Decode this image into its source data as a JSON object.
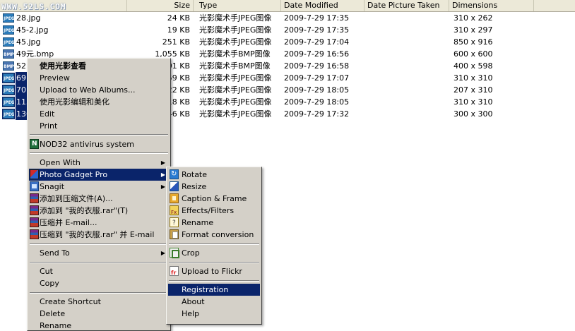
{
  "watermark": "WWW.52LS.COM",
  "columns": {
    "size": "Size",
    "type": "Type",
    "date_modified": "Date Modified",
    "date_taken": "Date Picture Taken",
    "dimensions": "Dimensions"
  },
  "files": [
    {
      "icon": "JPEG",
      "name": "28.jpg",
      "size": "24 KB",
      "type": "光影魔术手JPEG图像",
      "modified": "2009-7-29 17:35",
      "dimensions": "310 x 262",
      "selected": false
    },
    {
      "icon": "JPEG",
      "name": "45-2.jpg",
      "size": "19 KB",
      "type": "光影魔术手JPEG图像",
      "modified": "2009-7-29 17:35",
      "dimensions": "310 x 297",
      "selected": false
    },
    {
      "icon": "JPEG",
      "name": "45.jpg",
      "size": "251 KB",
      "type": "光影魔术手JPEG图像",
      "modified": "2009-7-29 17:04",
      "dimensions": "850 x 916",
      "selected": false
    },
    {
      "icon": "BMP",
      "name": "49元.bmp",
      "size": "1,055 KB",
      "type": "光影魔术手BMP图像",
      "modified": "2009-7-29 16:56",
      "dimensions": "600 x 600",
      "selected": false
    },
    {
      "icon": "BMP",
      "name": "52.",
      "size": "701 KB",
      "type": "光影魔术手BMP图像",
      "modified": "2009-7-29 16:58",
      "dimensions": "400 x 598",
      "selected": false
    },
    {
      "icon": "JPEG",
      "name": "69.",
      "size": "59 KB",
      "type": "光影魔术手JPEG图像",
      "modified": "2009-7-29 17:07",
      "dimensions": "310 x 310",
      "selected": true
    },
    {
      "icon": "JPEG",
      "name": "70.",
      "size": "22 KB",
      "type": "光影魔术手JPEG图像",
      "modified": "2009-7-29 18:05",
      "dimensions": "207 x 310",
      "selected": true
    },
    {
      "icon": "JPEG",
      "name": "115",
      "size": "18 KB",
      "type": "光影魔术手JPEG图像",
      "modified": "2009-7-29 18:05",
      "dimensions": "310 x 310",
      "selected": true
    },
    {
      "icon": "JPEG",
      "name": "136",
      "size": "46 KB",
      "type": "光影魔术手JPEG图像",
      "modified": "2009-7-29 17:32",
      "dimensions": "300 x 300",
      "selected": true
    }
  ],
  "context_menu": {
    "open_with_guangying": "使用光影查看",
    "preview": "Preview",
    "upload_web_albums": "Upload to Web Albums...",
    "edit_with_guangying": "使用光影编辑和美化",
    "edit": "Edit",
    "print": "Print",
    "nod32": "NOD32 antivirus system",
    "open_with": "Open With",
    "photo_gadget_pro": "Photo Gadget Pro",
    "snagit": "Snagit",
    "add_to_archive": "添加到压缩文件(A)...",
    "add_to_rar": "添加到 \"我的衣服.rar\"(T)",
    "compress_email": "压缩并 E-mail...",
    "compress_rar_email": "压缩到 \"我的衣服.rar\" 并 E-mail",
    "send_to": "Send To",
    "cut": "Cut",
    "copy": "Copy",
    "create_shortcut": "Create Shortcut",
    "delete": "Delete",
    "rename": "Rename"
  },
  "submenu": {
    "rotate": "Rotate",
    "resize": "Resize",
    "caption_frame": "Caption & Frame",
    "effects_filters": "Effects/Filters",
    "rename": "Rename",
    "format_conversion": "Format conversion",
    "crop": "Crop",
    "upload_flickr": "Upload to Flickr",
    "registration": "Registration",
    "about": "About",
    "help": "Help"
  },
  "colors": {
    "selection": "#0a246a",
    "menu_bg": "#d4d0c8",
    "header_bg": "#ece9d8"
  }
}
